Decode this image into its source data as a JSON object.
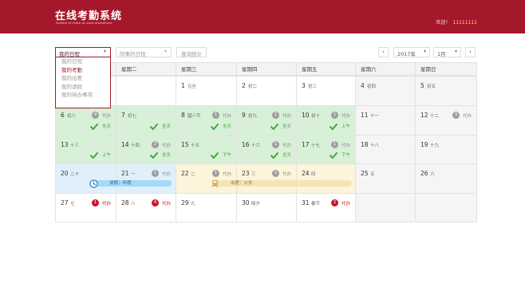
{
  "header": {
    "logo_cn": "在线考勤系统",
    "logo_en": "System of check on work attendance",
    "welcome": "欢迎！",
    "user_id": "11111111"
  },
  "toolbar": {
    "my_schedule": "我的日程",
    "colleague_schedule": "同事的日程",
    "query_stats": "查询统计",
    "caret": "▾"
  },
  "dropdown": {
    "items": [
      "我的日程",
      "我的考勤",
      "我的出差",
      "我的请假",
      "我的待办事项"
    ],
    "active_index": 1
  },
  "nav": {
    "prev": "‹",
    "next": "›",
    "year": "2017年",
    "month": "1月"
  },
  "weekdays": [
    "星期一",
    "星期二",
    "星期三",
    "星期四",
    "星期五",
    "星期六",
    "星期日"
  ],
  "weeks": [
    [
      {
        "day": "",
        "lunar": "",
        "bg": "white"
      },
      {
        "day": "",
        "lunar": "",
        "bg": "white"
      },
      {
        "day": "1",
        "lunar": "元旦",
        "bg": "white"
      },
      {
        "day": "2",
        "lunar": "初二",
        "bg": "white"
      },
      {
        "day": "3",
        "lunar": "初三",
        "bg": "white"
      },
      {
        "day": "4",
        "lunar": "初四",
        "bg": "gray"
      },
      {
        "day": "5",
        "lunar": "初五",
        "bg": "gray"
      }
    ],
    [
      {
        "day": "6",
        "lunar": "初八",
        "bg": "green",
        "badge": "4",
        "badge_label": "代办",
        "check": "全天"
      },
      {
        "day": "7",
        "lunar": "初七",
        "bg": "green",
        "check": "全天"
      },
      {
        "day": "8",
        "lunar": "腊八节",
        "bg": "green",
        "badge": "1",
        "badge_label": "代办",
        "check": "全天"
      },
      {
        "day": "9",
        "lunar": "初九",
        "bg": "green",
        "badge": "1",
        "badge_label": "代办",
        "check": "全天"
      },
      {
        "day": "10",
        "lunar": "初十",
        "bg": "green",
        "badge": "1",
        "badge_label": "代办",
        "check": "上午"
      },
      {
        "day": "11",
        "lunar": "十一",
        "bg": "gray"
      },
      {
        "day": "12",
        "lunar": "十二",
        "bg": "gray",
        "badge": "3",
        "badge_label": "代办"
      }
    ],
    [
      {
        "day": "13",
        "lunar": "十三",
        "bg": "green",
        "check": "上午"
      },
      {
        "day": "14",
        "lunar": "十四",
        "bg": "green",
        "badge": "2",
        "badge_label": "代办",
        "check": "全天"
      },
      {
        "day": "15",
        "lunar": "十五",
        "bg": "green",
        "check": "下午"
      },
      {
        "day": "16",
        "lunar": "十六",
        "bg": "green",
        "badge": "1",
        "badge_label": "代办",
        "check": "全天"
      },
      {
        "day": "17",
        "lunar": "十七",
        "bg": "green",
        "badge": "1",
        "badge_label": "代办",
        "check": "下午"
      },
      {
        "day": "18",
        "lunar": "十八",
        "bg": "gray"
      },
      {
        "day": "19",
        "lunar": "十九",
        "bg": "gray"
      }
    ],
    [
      {
        "day": "20",
        "lunar": "二十",
        "bg": "blue"
      },
      {
        "day": "21",
        "lunar": "一",
        "bg": "blue",
        "badge": "1",
        "badge_label": "代办"
      },
      {
        "day": "22",
        "lunar": "二",
        "bg": "yellow",
        "badge": "1",
        "badge_label": "代办"
      },
      {
        "day": "23",
        "lunar": "三",
        "bg": "yellow",
        "badge": "2",
        "badge_label": "代办"
      },
      {
        "day": "24",
        "lunar": "四",
        "bg": "yellow"
      },
      {
        "day": "25",
        "lunar": "五",
        "bg": "gray"
      },
      {
        "day": "26",
        "lunar": "六",
        "bg": "gray"
      }
    ],
    [
      {
        "day": "27",
        "lunar": "七",
        "bg": "white",
        "badge": "1",
        "badge_label": "代办",
        "badge_red": true
      },
      {
        "day": "28",
        "lunar": "八",
        "bg": "white",
        "badge": "4",
        "badge_label": "代办",
        "badge_red": true
      },
      {
        "day": "29",
        "lunar": "九",
        "bg": "white"
      },
      {
        "day": "30",
        "lunar": "除夕",
        "bg": "white"
      },
      {
        "day": "31",
        "lunar": "春节",
        "bg": "white",
        "badge": "2",
        "badge_label": "代办",
        "badge_red": true
      },
      {
        "day": "",
        "lunar": "",
        "bg": "gray"
      },
      {
        "day": "",
        "lunar": "",
        "bg": "gray"
      }
    ]
  ],
  "events": {
    "leave": "请假：年假",
    "trip": "出差：火车"
  },
  "colors": {
    "brand": "#a5182c",
    "green_cell": "#d8f0d7",
    "blue_cell": "#e0f0fb",
    "yellow_cell": "#fdf5db",
    "check": "#42a73c",
    "badge_red": "#d0112b"
  }
}
